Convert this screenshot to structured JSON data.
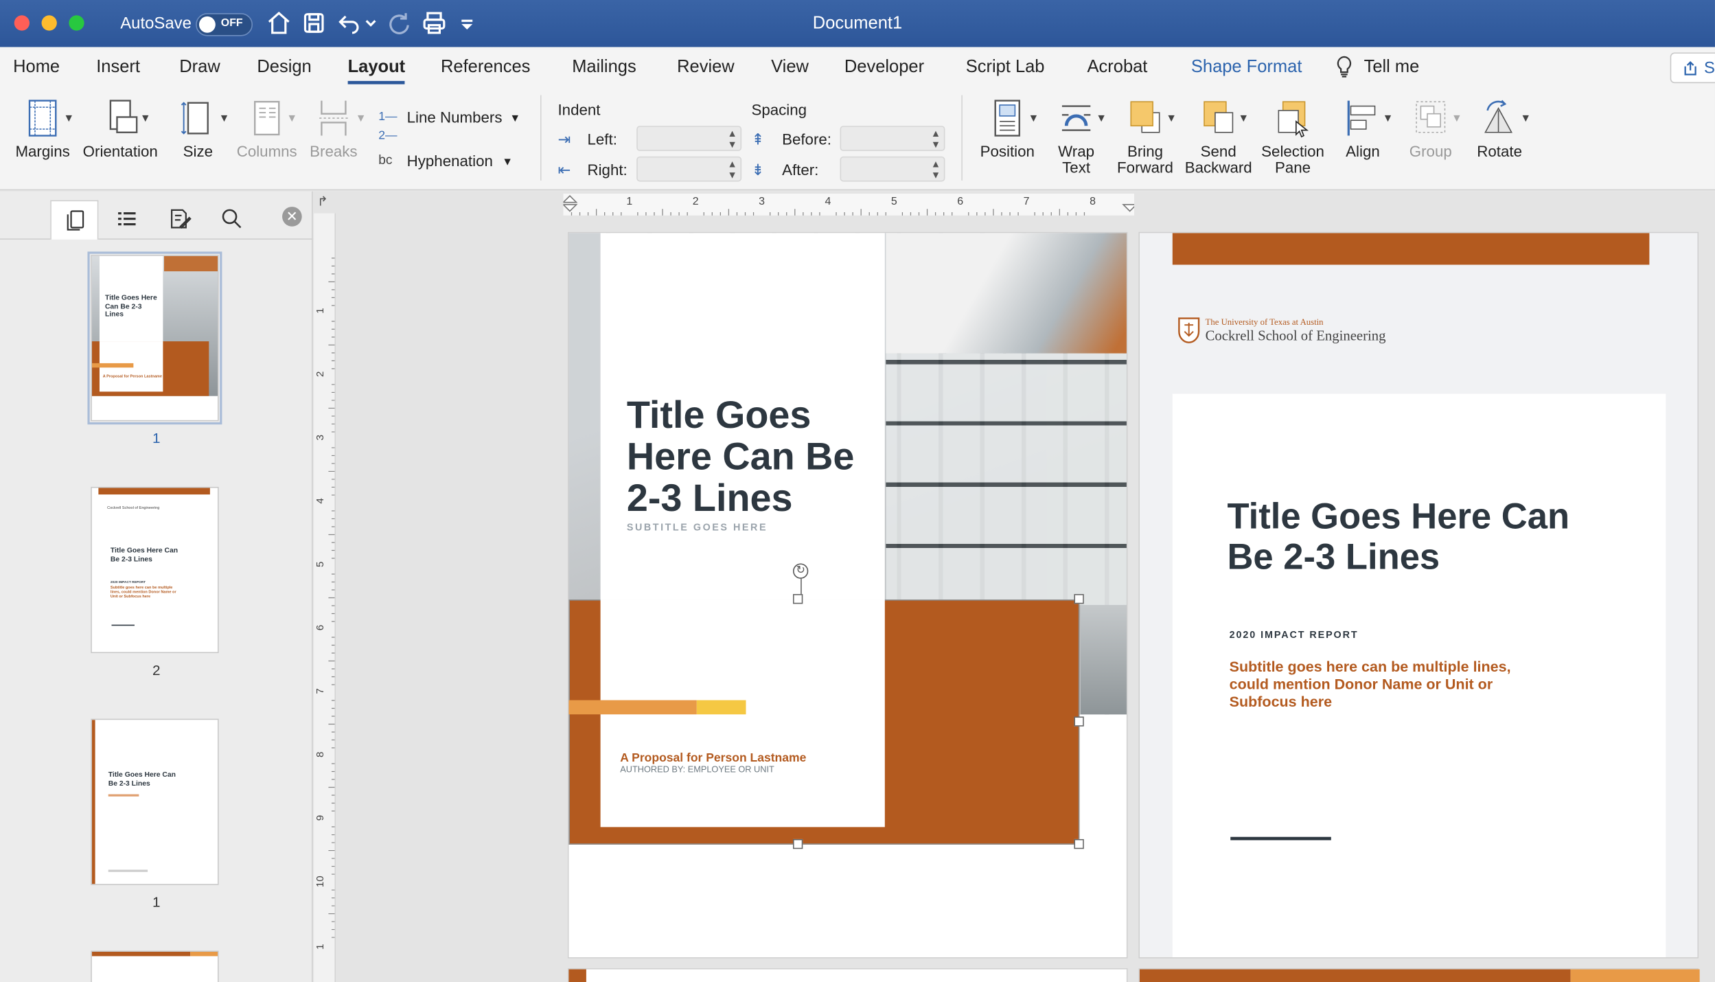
{
  "window": {
    "title": "Document1",
    "autosave_label": "AutoSave",
    "autosave_state": "OFF"
  },
  "menu": {
    "tabs": [
      "Home",
      "Insert",
      "Draw",
      "Design",
      "Layout",
      "References",
      "Mailings",
      "Review",
      "View",
      "Developer",
      "Script Lab",
      "Acrobat",
      "Shape Format"
    ],
    "active_tab": "Layout",
    "tell_me": "Tell me",
    "share_partial": "S"
  },
  "ribbon": {
    "margins": "Margins",
    "orientation": "Orientation",
    "size": "Size",
    "columns": "Columns",
    "breaks": "Breaks",
    "line_numbers": "Line Numbers",
    "hyphenation": "Hyphenation",
    "indent_heading": "Indent",
    "indent_left": "Left:",
    "indent_right": "Right:",
    "spacing_heading": "Spacing",
    "spacing_before": "Before:",
    "spacing_after": "After:",
    "position": "Position",
    "wrap_text": "Wrap Text",
    "bring_forward": "Bring Forward",
    "send_backward": "Send Backward",
    "selection_pane": "Selection Pane",
    "align": "Align",
    "group": "Group",
    "rotate": "Rotate"
  },
  "navpane": {
    "thumb_numbers": [
      "1",
      "2",
      "1"
    ],
    "thumb1": {
      "title": "Title Goes Here Can Be 2-3 Lines",
      "proposal": "A Proposal for Person Lastname"
    },
    "thumb2": {
      "title": "Title Goes Here Can Be 2-3 Lines",
      "report": "2020 IMPACT REPORT",
      "subtitle": "Subtitle goes here can be multiple lines, could mention Donor Name or Unit or Subfocus here",
      "school": "Cockrell School of Engineering"
    },
    "thumb3": {
      "title": "Title Goes Here Can Be 2-3 Lines"
    }
  },
  "ruler": {
    "h_numbers": [
      "1",
      "2",
      "3",
      "4",
      "5",
      "6",
      "7",
      "8"
    ],
    "v_numbers": [
      "1",
      "2",
      "3",
      "4",
      "5",
      "6",
      "7",
      "8",
      "9",
      "10",
      "1"
    ]
  },
  "page1": {
    "title": "Title Goes Here Can Be 2-3 Lines",
    "subtitle": "SUBTITLE GOES HERE",
    "proposal": "A Proposal for Person Lastname",
    "authored": "AUTHORED BY: EMPLOYEE OR UNIT"
  },
  "page2": {
    "university": "The University of Texas at Austin",
    "school": "Cockrell School of Engineering",
    "title": "Title Goes Here Can Be 2-3 Lines",
    "report": "2020 IMPACT REPORT",
    "subtitle": "Subtitle goes here can be multiple lines, could mention Donor Name or Unit or Subfocus here"
  },
  "colors": {
    "brand_blue": "#2b579a",
    "burnt_orange": "#b35a1f",
    "light_orange": "#e89a47",
    "yellow": "#f5c843",
    "charcoal": "#2d3740"
  }
}
